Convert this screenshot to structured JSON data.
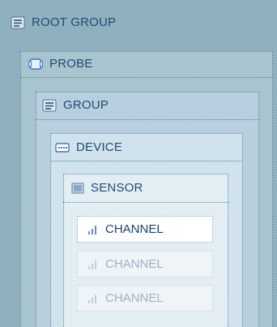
{
  "hierarchy": {
    "root_group": {
      "label": "ROOT GROUP",
      "icon": "group-icon"
    },
    "probe": {
      "label": "PROBE",
      "icon": "probe-icon"
    },
    "group": {
      "label": "GROUP",
      "icon": "group-icon"
    },
    "device": {
      "label": "DEVICE",
      "icon": "device-icon"
    },
    "sensor": {
      "label": "SENSOR",
      "icon": "sensor-icon"
    },
    "channels": [
      {
        "label": "CHANNEL",
        "icon": "channel-icon",
        "state": "active"
      },
      {
        "label": "CHANNEL",
        "icon": "channel-icon",
        "state": "dimmed"
      },
      {
        "label": "CHANNEL",
        "icon": "channel-icon",
        "state": "dimmed"
      }
    ]
  },
  "colors": {
    "root_bg": "#8fb1be",
    "probe_bg": "#a7c4cf",
    "group_bg": "#b7cfde",
    "device_bg": "#d0e2ec",
    "sensor_bg": "#e3eef4",
    "label_text": "#254a73"
  }
}
